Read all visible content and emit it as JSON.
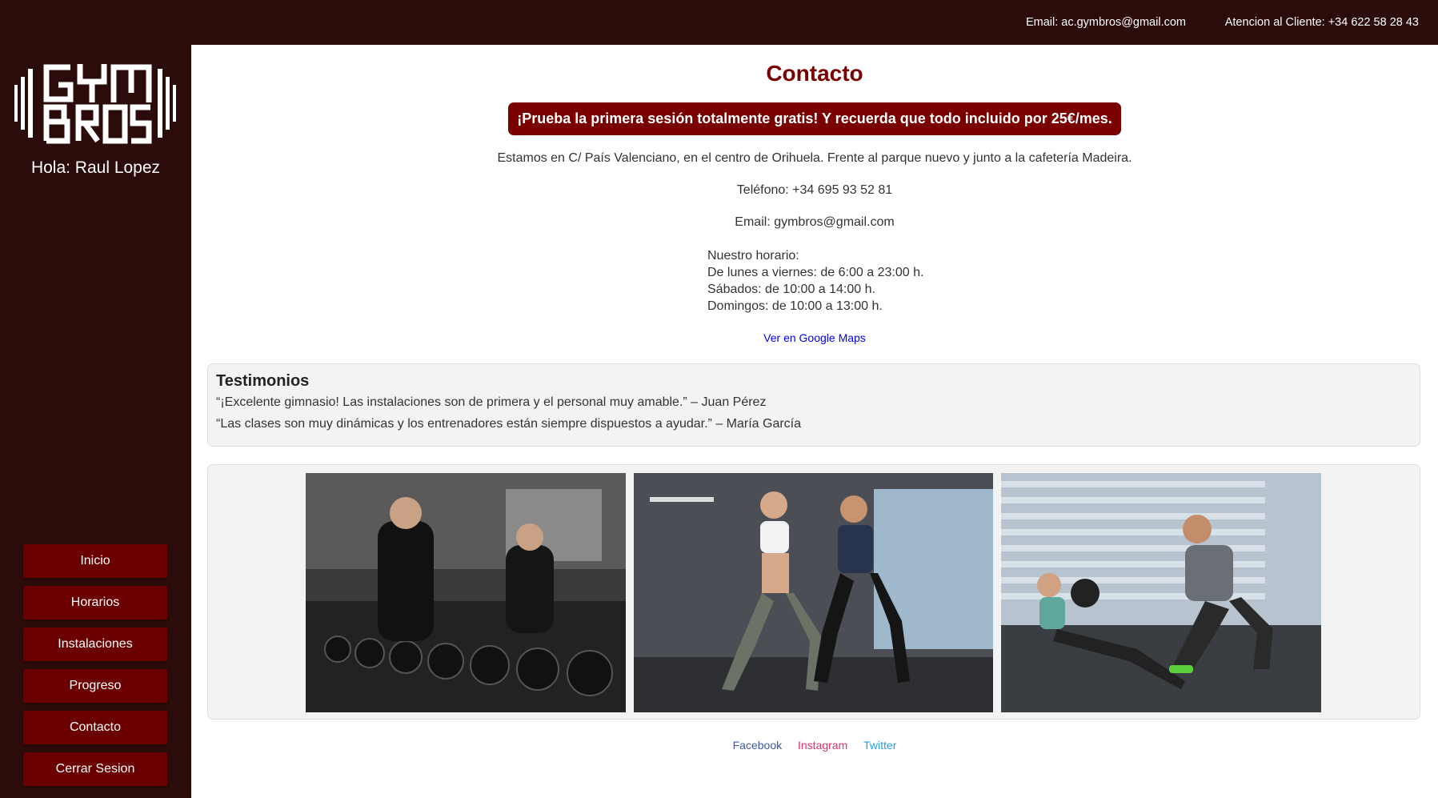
{
  "topbar": {
    "email": "Email: ac.gymbros@gmail.com",
    "phone": "Atencion al Cliente: +34 622 58 28 43"
  },
  "sidebar": {
    "logo_text": "GYM BROS",
    "greeting": "Hola: Raul Lopez",
    "nav": [
      "Inicio",
      "Horarios",
      "Instalaciones",
      "Progreso",
      "Contacto",
      "Cerrar Sesion"
    ]
  },
  "main": {
    "title": "Contacto",
    "promo": "¡Prueba la primera sesión totalmente gratis! Y recuerda que todo incluido por 25€/mes.",
    "address": "Estamos en C/ País Valenciano, en el centro de Orihuela. Frente al parque nuevo y junto a la cafetería Madeira.",
    "phone": "Teléfono: +34 695 93 52 81",
    "email": "Email: gymbros@gmail.com",
    "hours": [
      "Nuestro horario:",
      "De lunes a viernes: de 6:00 a 23:00 h.",
      "Sábados: de 10:00 a 14:00 h.",
      "Domingos: de 10:00 a 13:00 h."
    ],
    "maps_link": "Ver en Google Maps"
  },
  "testimonials": {
    "title": "Testimonios",
    "items": [
      "“¡Excelente gimnasio! Las instalaciones son de primera y el personal muy amable.” – Juan Pérez",
      "“Las clases son muy dinámicas y los entrenadores están siempre dispuestos a ayudar.” – María García"
    ]
  },
  "social": {
    "facebook": "Facebook",
    "instagram": "Instagram",
    "twitter": "Twitter"
  },
  "colors": {
    "dark_bg": "#2c0b0b",
    "accent": "#7a0000",
    "facebook": "#3b5998",
    "instagram": "#e1306c",
    "twitter": "#1da1f2"
  }
}
